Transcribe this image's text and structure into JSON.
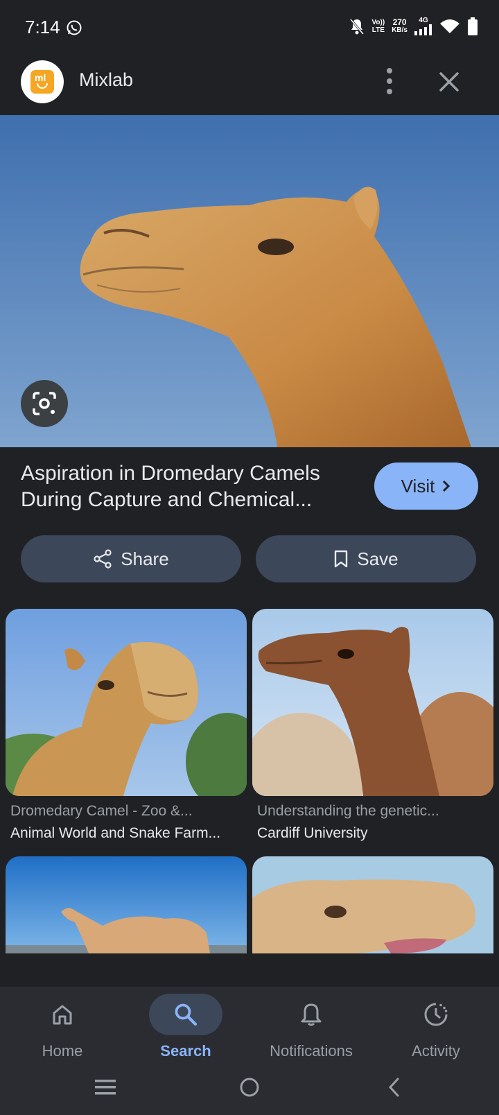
{
  "status_bar": {
    "time": "7:14",
    "volte_top": "Vo))",
    "volte_bottom": "LTE",
    "speed_value": "270",
    "speed_unit": "KB/s",
    "network": "4G"
  },
  "header": {
    "app_name": "Mixlab",
    "avatar_text": "ml"
  },
  "result": {
    "title": "Aspiration in Dromedary Camels During Capture and Chemical...",
    "visit_label": "Visit",
    "share_label": "Share",
    "save_label": "Save"
  },
  "related": [
    {
      "title": "Dromedary Camel - Zoo &...",
      "source": "Animal World and Snake Farm..."
    },
    {
      "title": "Understanding the genetic...",
      "source": "Cardiff University"
    }
  ],
  "bottom_nav": [
    {
      "label": "Home",
      "icon": "home-icon",
      "active": false
    },
    {
      "label": "Search",
      "icon": "search-icon",
      "active": true
    },
    {
      "label": "Notifications",
      "icon": "bell-icon",
      "active": false
    },
    {
      "label": "Activity",
      "icon": "activity-icon",
      "active": false
    }
  ],
  "colors": {
    "background": "#202124",
    "accent": "#8ab4f8",
    "button_bg": "#3c4859"
  }
}
